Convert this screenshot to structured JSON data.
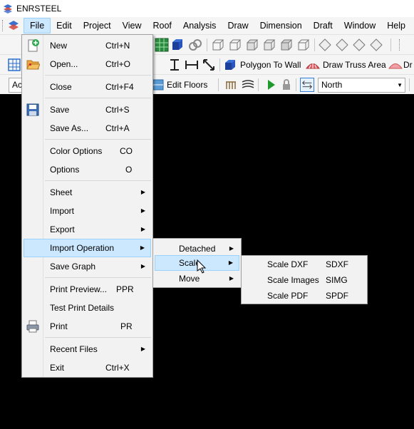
{
  "window": {
    "title": "ENRSTEEL",
    "title_icon": "app-logo-icon"
  },
  "menubar": {
    "items": [
      {
        "label": "File"
      },
      {
        "label": "Edit"
      },
      {
        "label": "Project"
      },
      {
        "label": "View"
      },
      {
        "label": "Roof"
      },
      {
        "label": "Analysis"
      },
      {
        "label": "Draw"
      },
      {
        "label": "Dimension"
      },
      {
        "label": "Draft"
      },
      {
        "label": "Window"
      },
      {
        "label": "Help"
      }
    ]
  },
  "toolbar2": {
    "polygon_to_wall": "Polygon To Wall",
    "draw_truss_area": "Draw Truss Area",
    "dr_cut": "Dr"
  },
  "toolbar3": {
    "combo_left": "Ac",
    "edit_floors": "Edit Floors",
    "direction_value": "North"
  },
  "file_menu": {
    "items": [
      {
        "label": "New",
        "shortcut": "Ctrl+N",
        "icon": "new-document-icon"
      },
      {
        "label": "Open...",
        "shortcut": "Ctrl+O",
        "icon": "open-folder-icon"
      },
      {
        "label": "Close",
        "shortcut": "Ctrl+F4"
      },
      {
        "label": "Save",
        "shortcut": "Ctrl+S",
        "icon": "save-disk-icon"
      },
      {
        "label": "Save As...",
        "shortcut": "Ctrl+A"
      },
      {
        "label": "Color Options",
        "shortcut": "CO"
      },
      {
        "label": "Options",
        "shortcut": "O"
      },
      {
        "label": "Sheet"
      },
      {
        "label": "Import"
      },
      {
        "label": "Export"
      },
      {
        "label": "Import Operation"
      },
      {
        "label": "Save Graph"
      },
      {
        "label": "Print Preview...",
        "shortcut": "PPR"
      },
      {
        "label": "Test Print Details"
      },
      {
        "label": "Print",
        "shortcut": "PR",
        "icon": "printer-icon"
      },
      {
        "label": "Recent Files"
      },
      {
        "label": "Exit",
        "shortcut": "Ctrl+X"
      }
    ]
  },
  "import_operation_menu": {
    "items": [
      {
        "label": "Detached"
      },
      {
        "label": "Scale"
      },
      {
        "label": "Move"
      }
    ]
  },
  "scale_menu": {
    "items": [
      {
        "label": "Scale DXF",
        "shortcut": "SDXF"
      },
      {
        "label": "Scale Images",
        "shortcut": "SIMG"
      },
      {
        "label": "Scale PDF",
        "shortcut": "SPDF"
      }
    ]
  },
  "colors": {
    "highlight": "#cce8ff",
    "highlight_border": "#99d1ff",
    "canvas": "#000000"
  }
}
